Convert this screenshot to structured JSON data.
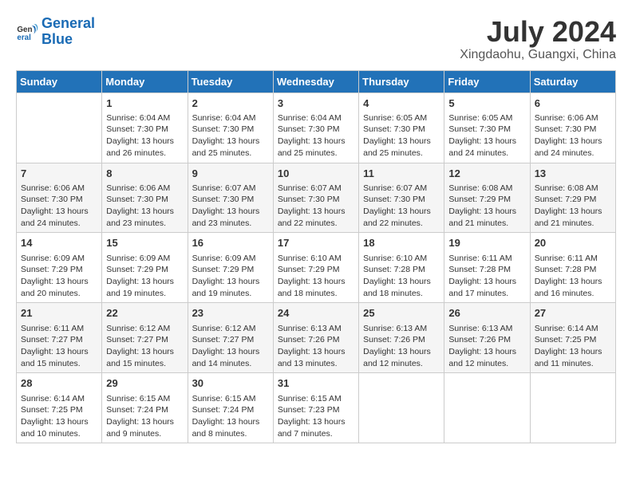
{
  "header": {
    "logo_general": "General",
    "logo_blue": "Blue",
    "main_title": "July 2024",
    "subtitle": "Xingdaohu, Guangxi, China"
  },
  "days_of_week": [
    "Sunday",
    "Monday",
    "Tuesday",
    "Wednesday",
    "Thursday",
    "Friday",
    "Saturday"
  ],
  "weeks": [
    [
      {
        "day": "",
        "info": ""
      },
      {
        "day": "1",
        "info": "Sunrise: 6:04 AM\nSunset: 7:30 PM\nDaylight: 13 hours\nand 26 minutes."
      },
      {
        "day": "2",
        "info": "Sunrise: 6:04 AM\nSunset: 7:30 PM\nDaylight: 13 hours\nand 25 minutes."
      },
      {
        "day": "3",
        "info": "Sunrise: 6:04 AM\nSunset: 7:30 PM\nDaylight: 13 hours\nand 25 minutes."
      },
      {
        "day": "4",
        "info": "Sunrise: 6:05 AM\nSunset: 7:30 PM\nDaylight: 13 hours\nand 25 minutes."
      },
      {
        "day": "5",
        "info": "Sunrise: 6:05 AM\nSunset: 7:30 PM\nDaylight: 13 hours\nand 24 minutes."
      },
      {
        "day": "6",
        "info": "Sunrise: 6:06 AM\nSunset: 7:30 PM\nDaylight: 13 hours\nand 24 minutes."
      }
    ],
    [
      {
        "day": "7",
        "info": "Sunrise: 6:06 AM\nSunset: 7:30 PM\nDaylight: 13 hours\nand 24 minutes."
      },
      {
        "day": "8",
        "info": "Sunrise: 6:06 AM\nSunset: 7:30 PM\nDaylight: 13 hours\nand 23 minutes."
      },
      {
        "day": "9",
        "info": "Sunrise: 6:07 AM\nSunset: 7:30 PM\nDaylight: 13 hours\nand 23 minutes."
      },
      {
        "day": "10",
        "info": "Sunrise: 6:07 AM\nSunset: 7:30 PM\nDaylight: 13 hours\nand 22 minutes."
      },
      {
        "day": "11",
        "info": "Sunrise: 6:07 AM\nSunset: 7:30 PM\nDaylight: 13 hours\nand 22 minutes."
      },
      {
        "day": "12",
        "info": "Sunrise: 6:08 AM\nSunset: 7:29 PM\nDaylight: 13 hours\nand 21 minutes."
      },
      {
        "day": "13",
        "info": "Sunrise: 6:08 AM\nSunset: 7:29 PM\nDaylight: 13 hours\nand 21 minutes."
      }
    ],
    [
      {
        "day": "14",
        "info": "Sunrise: 6:09 AM\nSunset: 7:29 PM\nDaylight: 13 hours\nand 20 minutes."
      },
      {
        "day": "15",
        "info": "Sunrise: 6:09 AM\nSunset: 7:29 PM\nDaylight: 13 hours\nand 19 minutes."
      },
      {
        "day": "16",
        "info": "Sunrise: 6:09 AM\nSunset: 7:29 PM\nDaylight: 13 hours\nand 19 minutes."
      },
      {
        "day": "17",
        "info": "Sunrise: 6:10 AM\nSunset: 7:29 PM\nDaylight: 13 hours\nand 18 minutes."
      },
      {
        "day": "18",
        "info": "Sunrise: 6:10 AM\nSunset: 7:28 PM\nDaylight: 13 hours\nand 18 minutes."
      },
      {
        "day": "19",
        "info": "Sunrise: 6:11 AM\nSunset: 7:28 PM\nDaylight: 13 hours\nand 17 minutes."
      },
      {
        "day": "20",
        "info": "Sunrise: 6:11 AM\nSunset: 7:28 PM\nDaylight: 13 hours\nand 16 minutes."
      }
    ],
    [
      {
        "day": "21",
        "info": "Sunrise: 6:11 AM\nSunset: 7:27 PM\nDaylight: 13 hours\nand 15 minutes."
      },
      {
        "day": "22",
        "info": "Sunrise: 6:12 AM\nSunset: 7:27 PM\nDaylight: 13 hours\nand 15 minutes."
      },
      {
        "day": "23",
        "info": "Sunrise: 6:12 AM\nSunset: 7:27 PM\nDaylight: 13 hours\nand 14 minutes."
      },
      {
        "day": "24",
        "info": "Sunrise: 6:13 AM\nSunset: 7:26 PM\nDaylight: 13 hours\nand 13 minutes."
      },
      {
        "day": "25",
        "info": "Sunrise: 6:13 AM\nSunset: 7:26 PM\nDaylight: 13 hours\nand 12 minutes."
      },
      {
        "day": "26",
        "info": "Sunrise: 6:13 AM\nSunset: 7:26 PM\nDaylight: 13 hours\nand 12 minutes."
      },
      {
        "day": "27",
        "info": "Sunrise: 6:14 AM\nSunset: 7:25 PM\nDaylight: 13 hours\nand 11 minutes."
      }
    ],
    [
      {
        "day": "28",
        "info": "Sunrise: 6:14 AM\nSunset: 7:25 PM\nDaylight: 13 hours\nand 10 minutes."
      },
      {
        "day": "29",
        "info": "Sunrise: 6:15 AM\nSunset: 7:24 PM\nDaylight: 13 hours\nand 9 minutes."
      },
      {
        "day": "30",
        "info": "Sunrise: 6:15 AM\nSunset: 7:24 PM\nDaylight: 13 hours\nand 8 minutes."
      },
      {
        "day": "31",
        "info": "Sunrise: 6:15 AM\nSunset: 7:23 PM\nDaylight: 13 hours\nand 7 minutes."
      },
      {
        "day": "",
        "info": ""
      },
      {
        "day": "",
        "info": ""
      },
      {
        "day": "",
        "info": ""
      }
    ]
  ]
}
